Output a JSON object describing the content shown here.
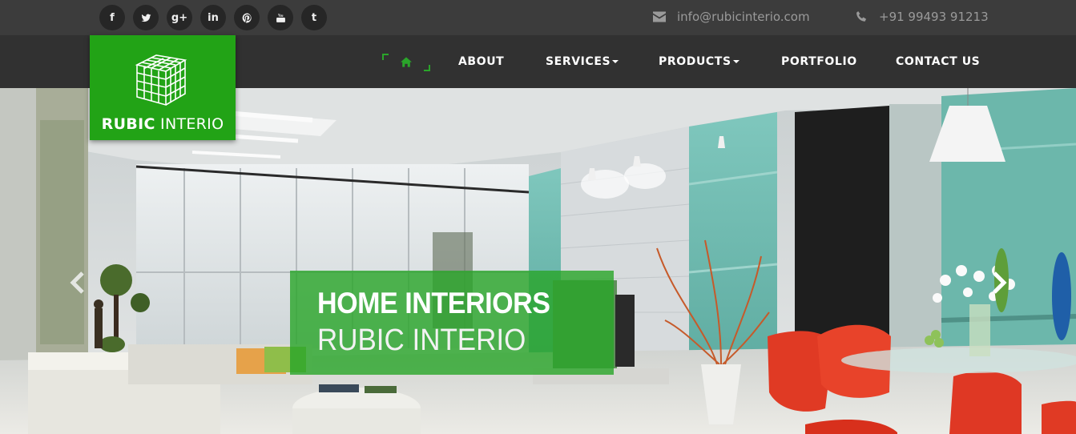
{
  "topbar": {
    "social": [
      {
        "name": "facebook-icon",
        "glyph": "f"
      },
      {
        "name": "twitter-icon",
        "glyph": ""
      },
      {
        "name": "google-plus-icon",
        "glyph": "g+"
      },
      {
        "name": "linkedin-icon",
        "glyph": "in"
      },
      {
        "name": "pinterest-icon",
        "glyph": ""
      },
      {
        "name": "youtube-icon",
        "glyph": ""
      },
      {
        "name": "tumblr-icon",
        "glyph": "t"
      }
    ],
    "email": "info@rubicinterio.com",
    "phone": "+91 99493 91213"
  },
  "logo": {
    "name_bold": "RUBIC",
    "name_light": "INTERIO"
  },
  "nav": {
    "home_icon": "home-icon",
    "items": [
      "ABOUT",
      "SERVICES",
      "PRODUCTS",
      "PORTFOLIO",
      "CONTACT US"
    ]
  },
  "hero": {
    "title": "HOME INTERIORS",
    "subtitle": "RUBIC INTERIO",
    "prev_icon": "chevron-left-icon",
    "next_icon": "chevron-right-icon"
  },
  "colors": {
    "brand_green": "#22a316",
    "topbar_bg": "#3c3c3c",
    "navbar_bg": "#313131",
    "caption_bg": "#28a528"
  }
}
